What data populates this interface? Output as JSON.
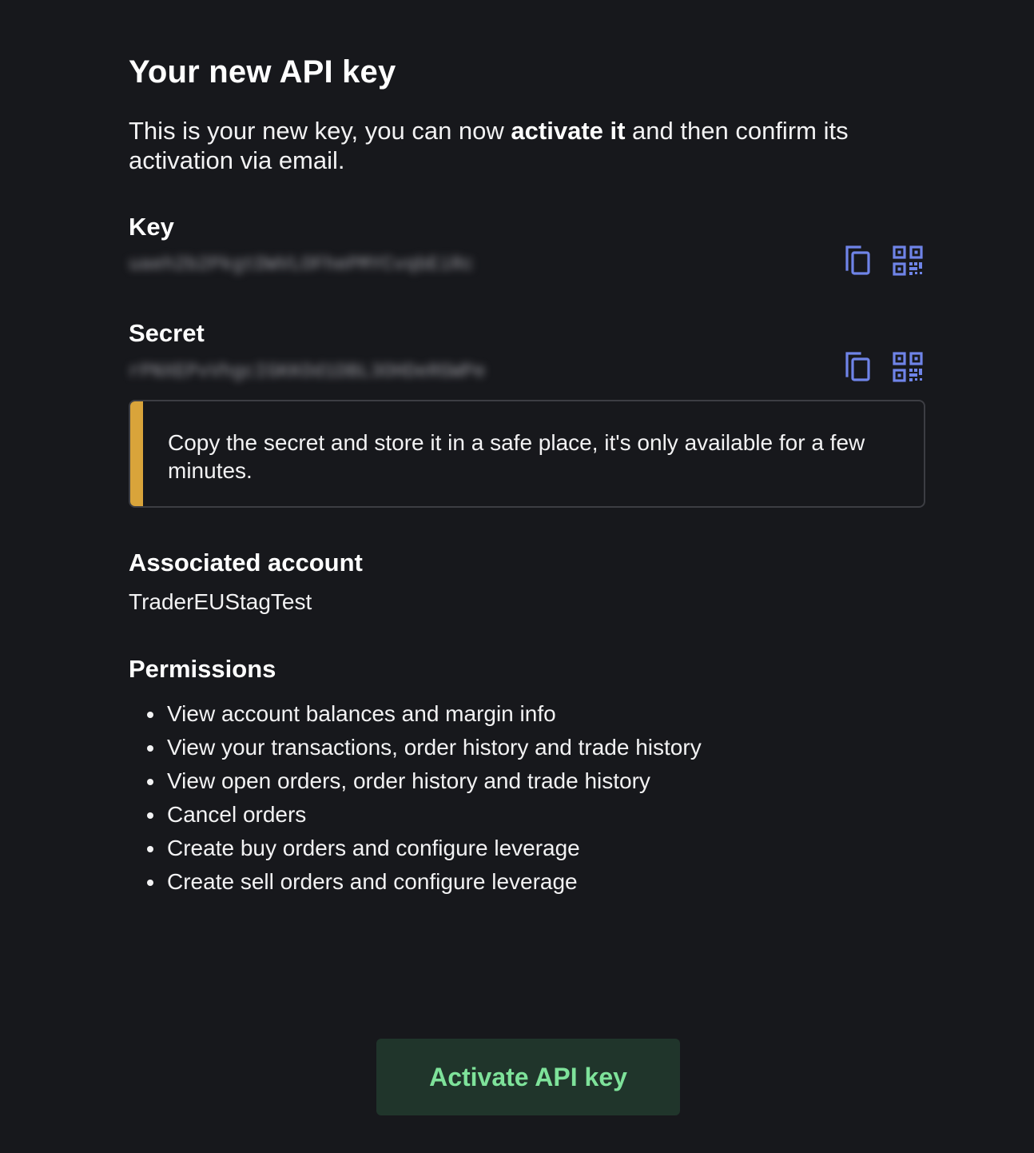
{
  "header": {
    "title": "Your new API key",
    "intro_prefix": "This is your new key, you can now ",
    "intro_emphasis": "activate it",
    "intro_suffix": " and then confirm its activation via email."
  },
  "key_field": {
    "label": "Key",
    "value_masked": "uaeh2b2PkgtDWVLOFhePMYCvqbEiRc"
  },
  "secret_field": {
    "label": "Secret",
    "value_masked": "rPNXEPvVhgcIGKKOd1DBL3OHDeRGWPe"
  },
  "notice": {
    "text": "Copy the secret and store it in a safe place, it's only available for a few minutes.",
    "accent_color": "#d9a43a"
  },
  "account": {
    "label": "Associated account",
    "value": "TraderEUStagTest"
  },
  "permissions": {
    "label": "Permissions",
    "items": [
      "View account balances and margin info",
      "View your transactions, order history and trade history",
      "View open orders, order history and trade history",
      "Cancel orders",
      "Create buy orders and configure leverage",
      "Create sell orders and configure leverage"
    ]
  },
  "actions": {
    "activate_label": "Activate API key"
  },
  "icons": {
    "copy": "copy-icon",
    "qr": "qr-code-icon"
  },
  "colors": {
    "background": "#17181c",
    "icon_accent": "#6f84e8",
    "button_bg": "#20352b",
    "button_text": "#7ee29a"
  }
}
